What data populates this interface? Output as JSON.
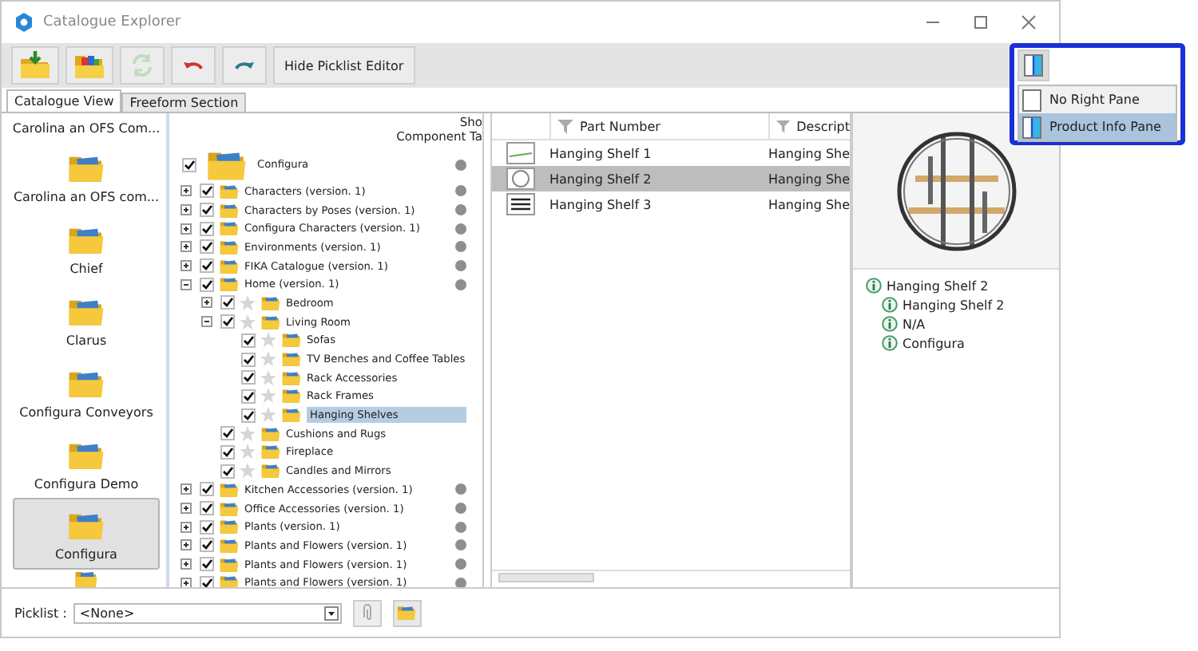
{
  "window": {
    "title": "Catalogue Explorer"
  },
  "toolbar": {
    "buttons": [
      {
        "kind": "import",
        "disabled": false
      },
      {
        "kind": "catalogue",
        "disabled": false
      },
      {
        "kind": "refresh",
        "disabled": true
      },
      {
        "kind": "undo",
        "disabled": false
      },
      {
        "kind": "redo",
        "disabled": false
      },
      {
        "kind": "text",
        "label": "Hide Picklist Editor",
        "disabled": false
      }
    ]
  },
  "tabs": [
    {
      "label": "Catalogue View",
      "selected": true
    },
    {
      "label": "Freeform Section",
      "selected": false
    }
  ],
  "catalogues": [
    {
      "kind": "label",
      "label": "Carolina an OFS Com...",
      "selected": false
    },
    {
      "kind": "full",
      "label": "Carolina an OFS com...",
      "selected": false
    },
    {
      "kind": "full",
      "label": "Chief",
      "selected": false
    },
    {
      "kind": "full",
      "label": "Clarus",
      "selected": false
    },
    {
      "kind": "full",
      "label": "Configura Conveyors",
      "selected": false
    },
    {
      "kind": "full",
      "label": "Configura Demo",
      "selected": false
    },
    {
      "kind": "full",
      "label": "Configura",
      "selected": true
    },
    {
      "kind": "icon",
      "selected": false
    }
  ],
  "tree": {
    "header": [
      "Sho",
      "Component Ta"
    ],
    "root": {
      "label": "Configura",
      "checked": true,
      "children": [
        {
          "label": "Characters (version. 1)",
          "checked": true,
          "expanded": false,
          "selected": false
        },
        {
          "label": "Characters by Poses (version. 1)",
          "checked": true,
          "expanded": false,
          "selected": false
        },
        {
          "label": "Configura Characters (version. 1)",
          "checked": true,
          "expanded": false,
          "selected": false
        },
        {
          "label": "Environments (version. 1)",
          "checked": true,
          "expanded": false,
          "selected": false
        },
        {
          "label": "FIKA Catalogue (version. 1)",
          "checked": true,
          "expanded": false,
          "selected": false
        },
        {
          "label": "Home (version. 1)",
          "checked": true,
          "expanded": true,
          "selected": false,
          "children": [
            {
              "label": "Bedroom",
              "checked": true,
              "expanded": false,
              "starred": false,
              "selected": false
            },
            {
              "label": "Living Room",
              "checked": true,
              "expanded": true,
              "starred": false,
              "selected": false,
              "children": [
                {
                  "label": "Sofas",
                  "checked": true,
                  "starred": false,
                  "selected": false
                },
                {
                  "label": "TV Benches and Coffee Tables",
                  "checked": true,
                  "starred": false,
                  "selected": false
                },
                {
                  "label": "Rack Accessories",
                  "checked": true,
                  "starred": false,
                  "selected": false
                },
                {
                  "label": "Rack Frames",
                  "checked": true,
                  "starred": false,
                  "selected": false
                },
                {
                  "label": "Hanging Shelves",
                  "checked": true,
                  "starred": false,
                  "selected": true
                }
              ]
            },
            {
              "label": "Cushions and Rugs",
              "checked": true,
              "starred": false,
              "selected": false
            },
            {
              "label": "Fireplace",
              "checked": true,
              "starred": false,
              "selected": false
            },
            {
              "label": "Candles and Mirrors",
              "checked": true,
              "starred": false,
              "selected": false
            }
          ]
        },
        {
          "label": "Kitchen Accessories (version. 1)",
          "checked": true,
          "expanded": false,
          "selected": false
        },
        {
          "label": "Office Accessories (version. 1)",
          "checked": true,
          "expanded": false,
          "selected": false
        },
        {
          "label": "Plants (version. 1)",
          "checked": true,
          "expanded": false,
          "selected": false
        },
        {
          "label": "Plants and Flowers (version. 1)",
          "checked": true,
          "expanded": false,
          "selected": false
        },
        {
          "label": "Plants and Flowers (version. 1)",
          "checked": true,
          "expanded": false,
          "selected": false
        },
        {
          "label": "Plants and Flowers (version. 1)",
          "checked": true,
          "expanded": false,
          "selected": false
        }
      ]
    }
  },
  "parts": {
    "columns": [
      "Part Number",
      "Descript"
    ],
    "rows": [
      {
        "part_number": "Hanging Shelf 1",
        "description": "Hanging She",
        "selected": false
      },
      {
        "part_number": "Hanging Shelf 2",
        "description": "Hanging She",
        "selected": true
      },
      {
        "part_number": "Hanging Shelf 3",
        "description": "Hanging She",
        "selected": false
      }
    ]
  },
  "product_info": {
    "label": "Hanging Shelf 2",
    "children": [
      {
        "label": "Hanging Shelf 2"
      },
      {
        "label": "N/A"
      },
      {
        "label": "Configura"
      }
    ]
  },
  "right_pane_menu": {
    "items": [
      {
        "label": "No Right Pane",
        "selected": false
      },
      {
        "label": "Product Info Pane",
        "selected": true
      }
    ]
  },
  "picklist": {
    "label": "Picklist :",
    "value": "<None>"
  }
}
